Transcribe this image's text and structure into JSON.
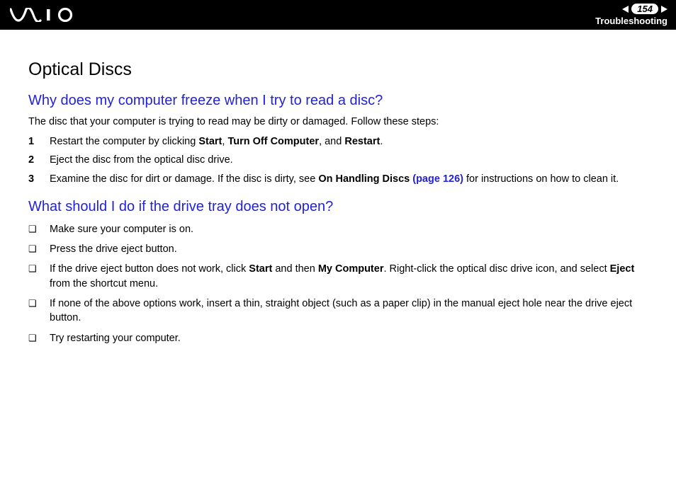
{
  "header": {
    "page_number": "154",
    "section": "Troubleshooting"
  },
  "content": {
    "title": "Optical Discs",
    "q1": {
      "heading": "Why does my computer freeze when I try to read a disc?",
      "intro": "The disc that your computer is trying to read may be dirty or damaged. Follow these steps:",
      "steps": [
        {
          "num": "1",
          "parts": [
            "Restart the computer by clicking ",
            "Start",
            ", ",
            "Turn Off Computer",
            ", and ",
            "Restart",
            "."
          ]
        },
        {
          "num": "2",
          "text": "Eject the disc from the optical disc drive."
        },
        {
          "num": "3",
          "pre": "Examine the disc for dirt or damage. If the disc is dirty, see ",
          "bold": "On Handling Discs ",
          "link": "(page 126)",
          "post": " for instructions on how to clean it."
        }
      ]
    },
    "q2": {
      "heading": "What should I do if the drive tray does not open?",
      "bullets": [
        {
          "text": "Make sure your computer is on."
        },
        {
          "text": "Press the drive eject button."
        },
        {
          "parts": [
            "If the drive eject button does not work, click ",
            "Start",
            " and then ",
            "My Computer",
            ". Right-click the optical disc drive icon, and select ",
            "Eject",
            " from the shortcut menu."
          ]
        },
        {
          "text": "If none of the above options work, insert a thin, straight object (such as a paper clip) in the manual eject hole near the drive eject button."
        },
        {
          "text": "Try restarting your computer."
        }
      ]
    }
  }
}
